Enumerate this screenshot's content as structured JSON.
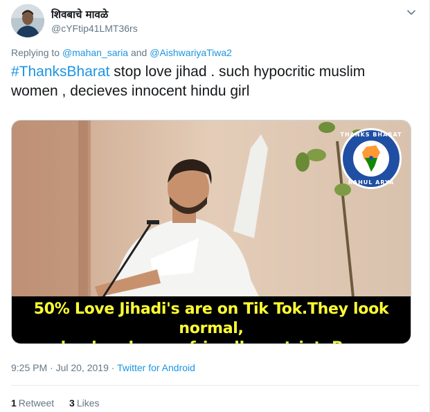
{
  "author": {
    "display_name": "शिवबाचे मावळे",
    "handle": "@cYFtip41LMT36rs"
  },
  "reply": {
    "prefix": "Replying to",
    "user1": "@mahan_saria",
    "conjunction": "and",
    "user2": "@AishwariyaTiwa2"
  },
  "tweet": {
    "hashtag": "#ThanksBharat",
    "text": " stop love jihad . such hypocritic muslim women , decieves innocent hindu girl"
  },
  "media": {
    "caption_line1": "50% Love Jihadi's are on Tik Tok.They look normal,",
    "caption_line2": "secular, handsome, friendly, patriot. Beware.",
    "logo_top_text": "THANKS BHARAT",
    "logo_bottom_text": "RAHUL ARYA"
  },
  "meta": {
    "time": "9:25 PM",
    "separator": " · ",
    "date": "Jul 20, 2019",
    "source": "Twitter for Android"
  },
  "stats": {
    "retweets_count": "1",
    "retweets_label": "Retweet",
    "likes_count": "3",
    "likes_label": "Likes"
  },
  "colors": {
    "link": "#1b95e0",
    "muted": "#657786",
    "caption_text": "#ffff33"
  },
  "icons": {
    "more": "chevron-down-icon",
    "logo": "india-map-emblem-icon"
  }
}
